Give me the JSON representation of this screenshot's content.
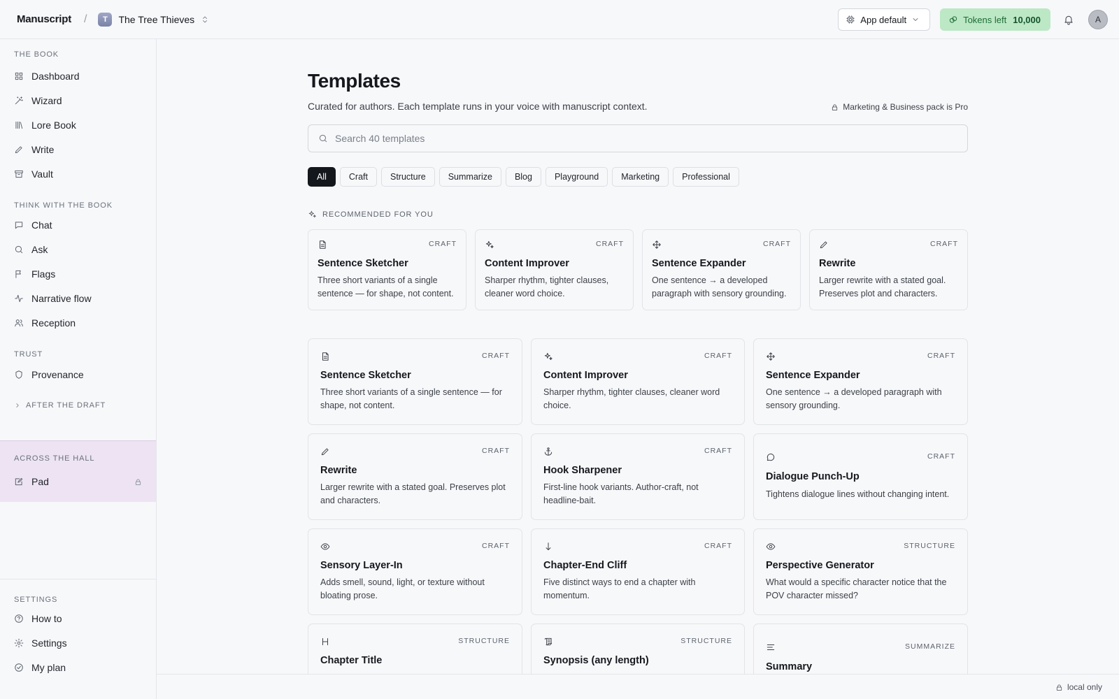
{
  "header": {
    "brand": "Manuscript",
    "separator": "/",
    "project_initial": "T",
    "project_name": "The Tree Thieves",
    "model_label": "App default",
    "tokens_label": "Tokens left",
    "tokens_value": "10,000",
    "avatar_initial": "A",
    "colors": {
      "tokens_bg": "#bce8c5",
      "tokens_text": "#1f6b35"
    }
  },
  "sidebar": {
    "sections": [
      {
        "title": "THE BOOK",
        "items": [
          {
            "label": "Dashboard",
            "icon": "grid-icon"
          },
          {
            "label": "Wizard",
            "icon": "magic-wand-icon"
          },
          {
            "label": "Lore Book",
            "icon": "library-icon"
          },
          {
            "label": "Write",
            "icon": "pencil-icon"
          },
          {
            "label": "Vault",
            "icon": "archive-icon"
          }
        ]
      },
      {
        "title": "THINK WITH THE BOOK",
        "items": [
          {
            "label": "Chat",
            "icon": "chat-icon"
          },
          {
            "label": "Ask",
            "icon": "search-icon"
          },
          {
            "label": "Flags",
            "icon": "flag-icon"
          },
          {
            "label": "Narrative flow",
            "icon": "activity-icon"
          },
          {
            "label": "Reception",
            "icon": "users-icon"
          }
        ]
      },
      {
        "title": "TRUST",
        "items": [
          {
            "label": "Provenance",
            "icon": "shield-icon"
          }
        ]
      }
    ],
    "after_draft": "AFTER THE DRAFT",
    "across_hall": {
      "title": "ACROSS THE HALL",
      "item": "Pad",
      "color": "#ede3f3"
    },
    "settings": {
      "title": "SETTINGS",
      "items": [
        {
          "label": "How to",
          "icon": "help-circle-icon"
        },
        {
          "label": "Settings",
          "icon": "gear-icon"
        },
        {
          "label": "My plan",
          "icon": "check-circle-icon"
        }
      ]
    }
  },
  "main": {
    "title": "Templates",
    "subtitle": "Curated for authors. Each template runs in your voice with manuscript context.",
    "pro_note": "Marketing & Business pack is Pro",
    "search_placeholder": "Search 40 templates",
    "filters": [
      "All",
      "Craft",
      "Structure",
      "Summarize",
      "Blog",
      "Playground",
      "Marketing",
      "Professional"
    ],
    "active_filter": "All",
    "recommended_title": "RECOMMENDED FOR YOU",
    "recommended": [
      {
        "icon": "document-icon",
        "tag": "CRAFT",
        "title": "Sentence Sketcher",
        "desc": "Three short variants of a single sentence — for shape, not content."
      },
      {
        "icon": "sparkles-icon",
        "tag": "CRAFT",
        "title": "Content Improver",
        "desc": "Sharper rhythm, tighter clauses, cleaner word choice."
      },
      {
        "icon": "move-icon",
        "tag": "CRAFT",
        "title": "Sentence Expander",
        "desc": "One sentence → a developed paragraph with sensory grounding."
      },
      {
        "icon": "pencil-icon",
        "tag": "CRAFT",
        "title": "Rewrite",
        "desc": "Larger rewrite with a stated goal. Preserves plot and characters."
      }
    ],
    "templates": [
      {
        "icon": "document-icon",
        "tag": "CRAFT",
        "title": "Sentence Sketcher",
        "desc": "Three short variants of a single sentence — for shape, not content."
      },
      {
        "icon": "sparkles-icon",
        "tag": "CRAFT",
        "title": "Content Improver",
        "desc": "Sharper rhythm, tighter clauses, cleaner word choice."
      },
      {
        "icon": "move-icon",
        "tag": "CRAFT",
        "title": "Sentence Expander",
        "desc": "One sentence → a developed paragraph with sensory grounding."
      },
      {
        "icon": "pencil-icon",
        "tag": "CRAFT",
        "title": "Rewrite",
        "desc": "Larger rewrite with a stated goal. Preserves plot and characters."
      },
      {
        "icon": "anchor-icon",
        "tag": "CRAFT",
        "title": "Hook Sharpener",
        "desc": "First-line hook variants. Author-craft, not headline-bait."
      },
      {
        "icon": "speech-bubble-icon",
        "tag": "CRAFT",
        "title": "Dialogue Punch-Up",
        "desc": "Tightens dialogue lines without changing intent."
      },
      {
        "icon": "eye-icon",
        "tag": "CRAFT",
        "title": "Sensory Layer-In",
        "desc": "Adds smell, sound, light, or texture without bloating prose."
      },
      {
        "icon": "arrow-down-icon",
        "tag": "CRAFT",
        "title": "Chapter-End Cliff",
        "desc": "Five distinct ways to end a chapter with momentum."
      },
      {
        "icon": "eye-icon",
        "tag": "STRUCTURE",
        "title": "Perspective Generator",
        "desc": "What would a specific character notice that the POV character missed?"
      },
      {
        "icon": "heading-icon",
        "tag": "STRUCTURE",
        "title": "Chapter Title",
        "desc": ""
      },
      {
        "icon": "scroll-icon",
        "tag": "STRUCTURE",
        "title": "Synopsis (any length)",
        "desc": ""
      },
      {
        "icon": "align-left-icon",
        "tag": "SUMMARIZE",
        "title": "Summary",
        "desc": ""
      }
    ]
  },
  "footer": {
    "note": "local only"
  }
}
